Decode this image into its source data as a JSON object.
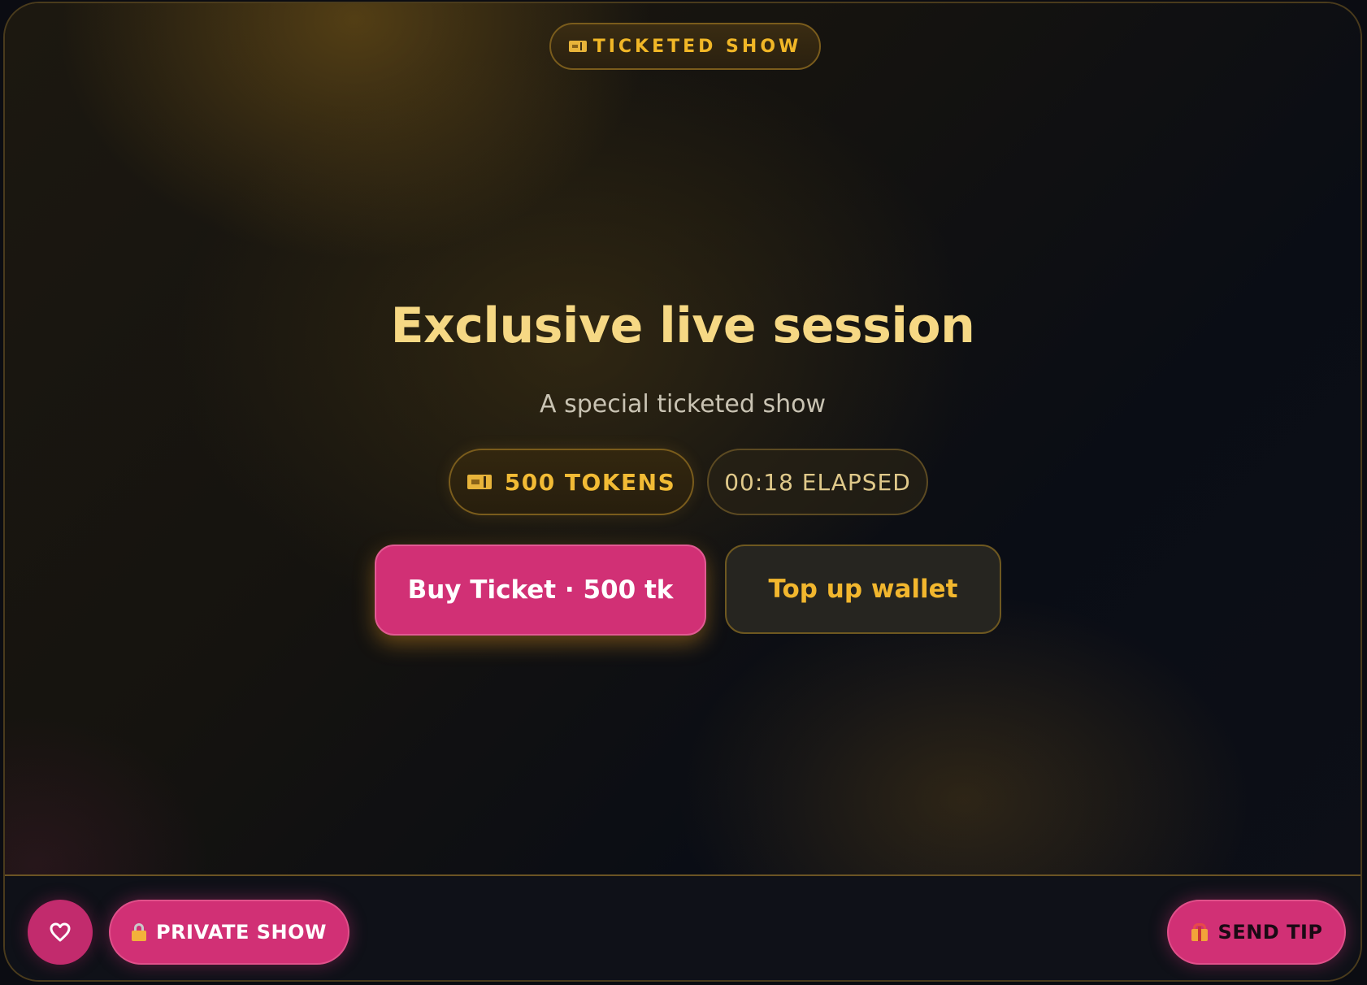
{
  "stage": {
    "badge_label": "TICKETED SHOW",
    "badge_icon": "ticket-icon",
    "title": "Exclusive live session",
    "subtitle": "A special ticketed show",
    "price_chip": {
      "icon": "ticket-icon",
      "label": "500 TOKENS"
    },
    "elapsed_chip": {
      "label": "00:18 ELAPSED"
    },
    "buy_button_label": "Buy Ticket · 500 tk",
    "topup_button_label": "Top up wallet"
  },
  "bottom_bar": {
    "heart_icon": "heart-icon",
    "private_show_label": "PRIVATE SHOW",
    "private_show_icon": "lock-icon",
    "send_tip_label": "SEND TIP",
    "send_tip_icon": "gift-icon"
  },
  "colors": {
    "accent_gold": "#f2b72e",
    "accent_pink": "#d13075",
    "title_gold": "#f6d884",
    "background": "#0f1016"
  }
}
